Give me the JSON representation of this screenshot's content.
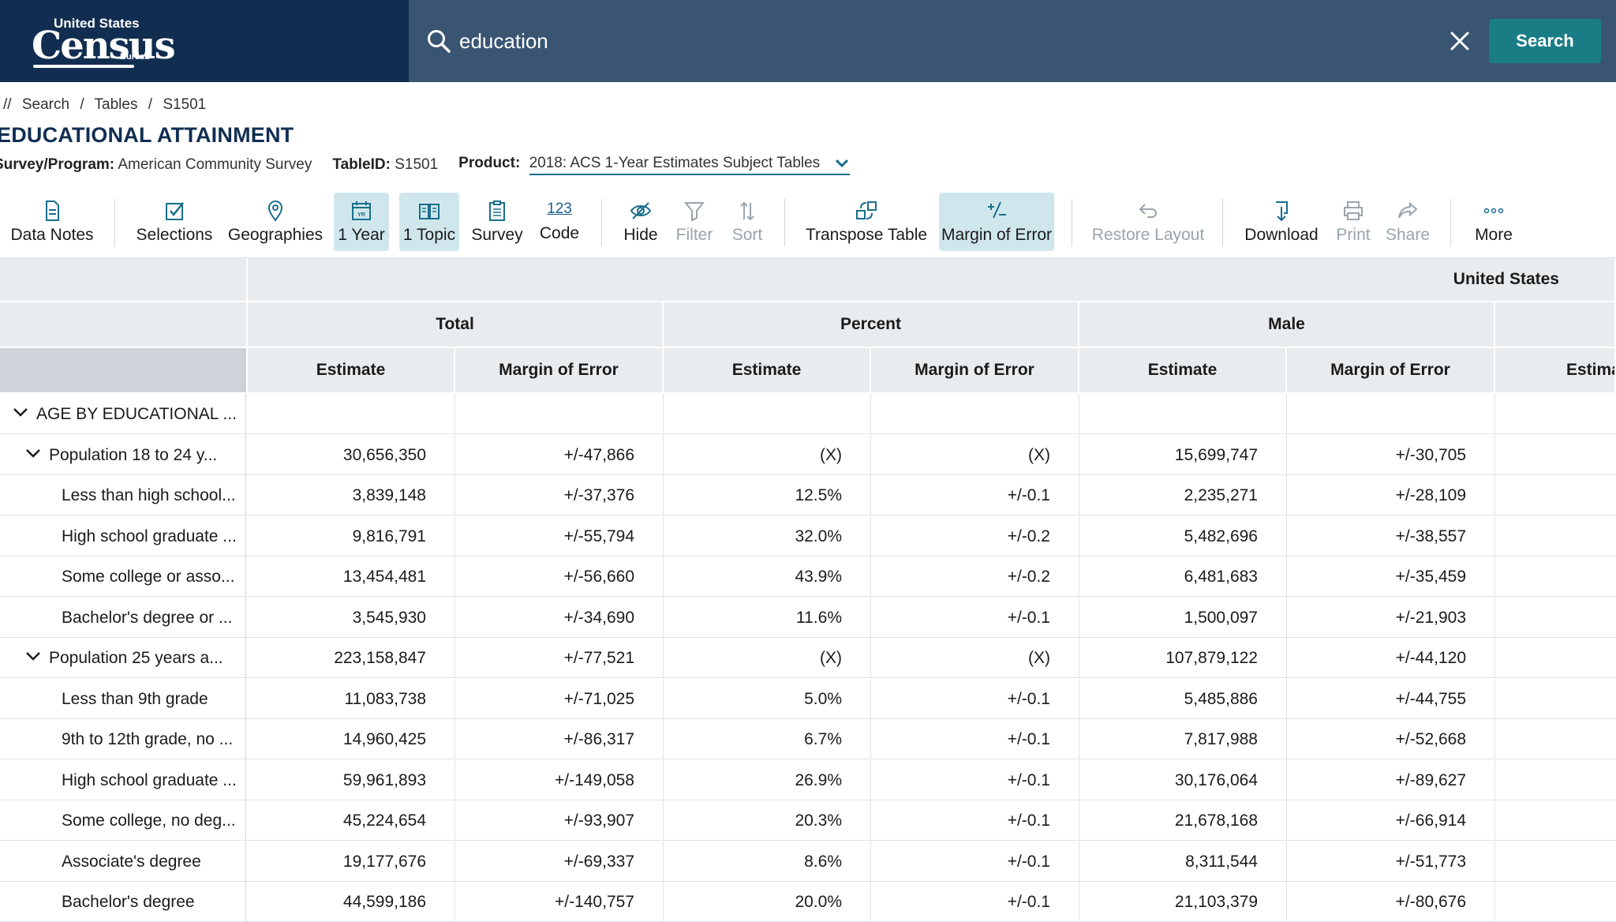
{
  "header": {
    "logo_line1": "United States",
    "logo_line2": "Census",
    "logo_line3": "Bureau",
    "search_value": "education",
    "search_button": "Search"
  },
  "breadcrumb": [
    "//",
    "Search",
    "Tables",
    "S1501"
  ],
  "page": {
    "title": "EDUCATIONAL ATTAINMENT",
    "survey_label": "Survey/Program:",
    "survey_value": "American Community Survey",
    "tableid_label": "TableID:",
    "tableid_value": "S1501",
    "product_label": "Product:",
    "product_value": "2018: ACS 1-Year Estimates Subject Tables"
  },
  "toolbar": {
    "data_notes": "Data Notes",
    "selections": "Selections",
    "geographies": "Geographies",
    "year": "1 Year",
    "topic": "1 Topic",
    "survey": "Survey",
    "code_icon_text": "123",
    "code": "Code",
    "hide": "Hide",
    "filter": "Filter",
    "sort": "Sort",
    "transpose": "Transpose Table",
    "margin": "Margin of Error",
    "restore": "Restore Layout",
    "download": "Download",
    "print": "Print",
    "share": "Share",
    "more": "More"
  },
  "table": {
    "geo_header": "United States",
    "groups": [
      "Total",
      "Percent",
      "Male"
    ],
    "subheaders": [
      "Estimate",
      "Margin of Error",
      "Estimate",
      "Margin of Error",
      "Estimate",
      "Margin of Error",
      "Estima"
    ],
    "rows": [
      {
        "label": "AGE BY EDUCATIONAL ...",
        "level": 0,
        "expander": true,
        "values": [
          "",
          "",
          "",
          "",
          "",
          ""
        ]
      },
      {
        "label": "Population 18 to 24 y...",
        "level": 1,
        "expander": true,
        "values": [
          "30,656,350",
          "+/-47,866",
          "(X)",
          "(X)",
          "15,699,747",
          "+/-30,705"
        ]
      },
      {
        "label": "Less than high school...",
        "level": 2,
        "expander": false,
        "values": [
          "3,839,148",
          "+/-37,376",
          "12.5%",
          "+/-0.1",
          "2,235,271",
          "+/-28,109"
        ]
      },
      {
        "label": "High school graduate ...",
        "level": 2,
        "expander": false,
        "values": [
          "9,816,791",
          "+/-55,794",
          "32.0%",
          "+/-0.2",
          "5,482,696",
          "+/-38,557"
        ]
      },
      {
        "label": "Some college or asso...",
        "level": 2,
        "expander": false,
        "values": [
          "13,454,481",
          "+/-56,660",
          "43.9%",
          "+/-0.2",
          "6,481,683",
          "+/-35,459"
        ]
      },
      {
        "label": "Bachelor's degree or ...",
        "level": 2,
        "expander": false,
        "values": [
          "3,545,930",
          "+/-34,690",
          "11.6%",
          "+/-0.1",
          "1,500,097",
          "+/-21,903"
        ]
      },
      {
        "label": "Population 25 years a...",
        "level": 1,
        "expander": true,
        "values": [
          "223,158,847",
          "+/-77,521",
          "(X)",
          "(X)",
          "107,879,122",
          "+/-44,120"
        ]
      },
      {
        "label": "Less than 9th grade",
        "level": 2,
        "expander": false,
        "values": [
          "11,083,738",
          "+/-71,025",
          "5.0%",
          "+/-0.1",
          "5,485,886",
          "+/-44,755"
        ]
      },
      {
        "label": "9th to 12th grade, no ...",
        "level": 2,
        "expander": false,
        "values": [
          "14,960,425",
          "+/-86,317",
          "6.7%",
          "+/-0.1",
          "7,817,988",
          "+/-52,668"
        ]
      },
      {
        "label": "High school graduate ...",
        "level": 2,
        "expander": false,
        "values": [
          "59,961,893",
          "+/-149,058",
          "26.9%",
          "+/-0.1",
          "30,176,064",
          "+/-89,627"
        ]
      },
      {
        "label": "Some college, no deg...",
        "level": 2,
        "expander": false,
        "values": [
          "45,224,654",
          "+/-93,907",
          "20.3%",
          "+/-0.1",
          "21,678,168",
          "+/-66,914"
        ]
      },
      {
        "label": "Associate's degree",
        "level": 2,
        "expander": false,
        "values": [
          "19,177,676",
          "+/-69,337",
          "8.6%",
          "+/-0.1",
          "8,311,544",
          "+/-51,773"
        ]
      },
      {
        "label": "Bachelor's degree",
        "level": 2,
        "expander": false,
        "values": [
          "44,599,186",
          "+/-140,757",
          "20.0%",
          "+/-0.1",
          "21,103,379",
          "+/-80,676"
        ]
      }
    ]
  },
  "colors": {
    "header_dark": "#112e51",
    "header_search": "#3a5572",
    "accent": "#1a7d85",
    "active_tool": "#cfe7ec"
  }
}
